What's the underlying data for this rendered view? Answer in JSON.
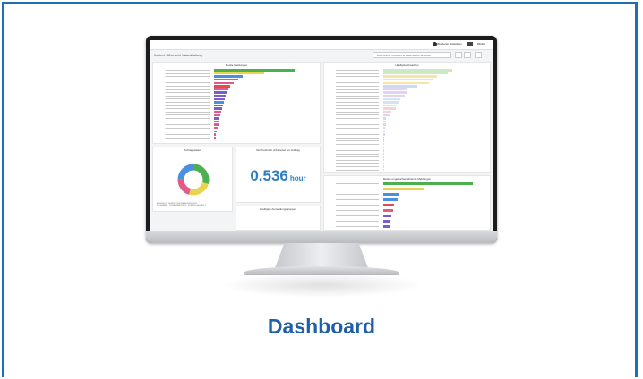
{
  "caption": "Dashboard",
  "colors": {
    "accent": "#1f5fa8",
    "bar_green": "#4caf50",
    "bar_yellow": "#e8d44d",
    "bar_blue": "#4a8fe0",
    "bar_purple": "#7b5cc9",
    "bar_pink": "#e05b8a",
    "bar_red": "#e04c4c"
  },
  "screen": {
    "topbar": {
      "user": "Mitarbeiter Statistiken",
      "lang": "DE/EN"
    },
    "breadcrumb": "Kontext › Übersicht Instandhaltung",
    "date_range": "2022-04-01 10:00:00 to 2022-04-30 12:00:00",
    "panels": {
      "top_left": {
        "title": "Meiste Meldungen"
      },
      "top_right": {
        "title": "Häufigste Ursachen"
      },
      "donut": {
        "title": "Auftragsstatus",
        "legend": [
          "ERLEDIGT",
          "OFFEN",
          "TEILWEISE ERLEDIGT",
          "STORNIERT",
          "IN BEARBEITUNG",
          "ZURÜCKGESTELLT"
        ]
      },
      "kpi": {
        "title": "Durchschnittl. Arbeitszeit pro Auftrag",
        "value": "0.536",
        "unit": "hour"
      },
      "bottom_right": {
        "title": "Meiste ungebuchte/fehlende Meldungen"
      },
      "bottom_mid": {
        "title": "Häufigste Anmeldungsgruppen"
      }
    }
  }
}
